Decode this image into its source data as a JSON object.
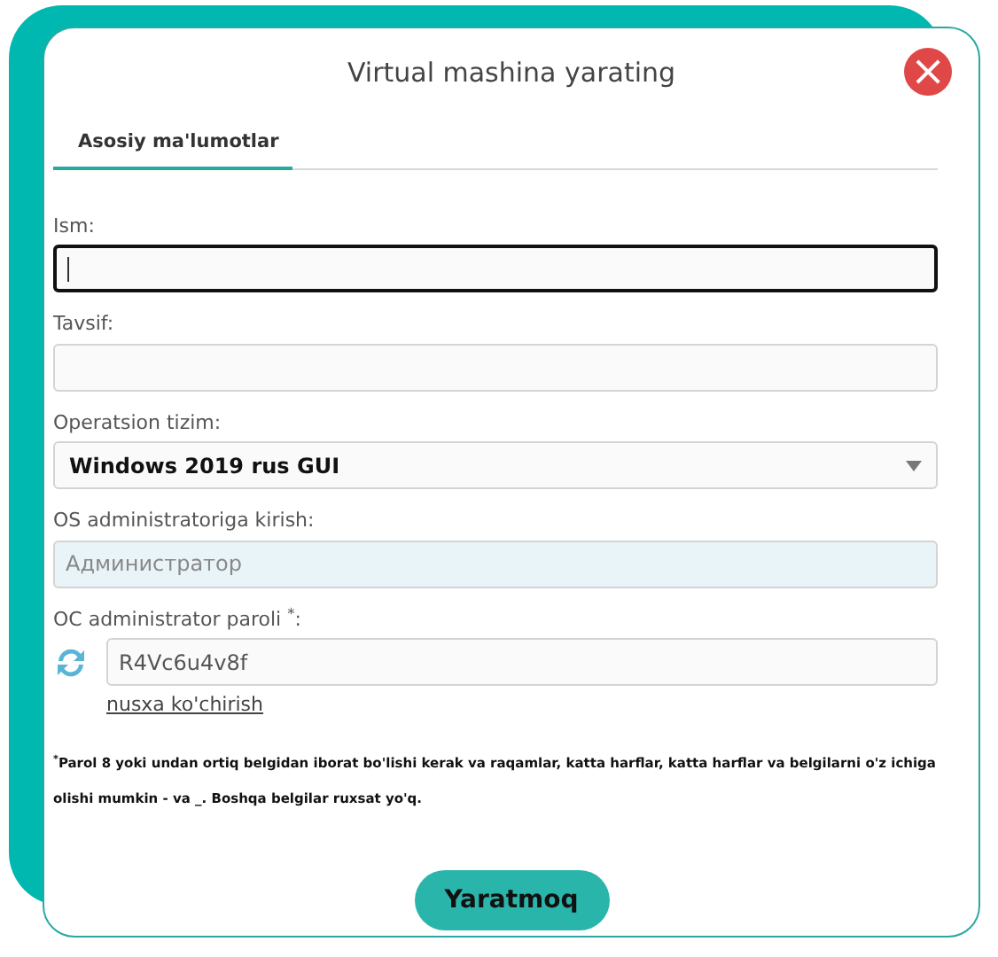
{
  "dialog": {
    "title": "Virtual mashina yarating",
    "close": "×"
  },
  "tabs": [
    {
      "label": "Asosiy ma'lumotlar",
      "selected": true
    }
  ],
  "fields": [
    {
      "kind": "text",
      "label": "Ism:",
      "focused": true
    },
    {
      "kind": "text",
      "label": "Tavsif:",
      "focused": false
    },
    {
      "kind": "select",
      "label": "Operatsion tizim:",
      "value": "Windows 2019 rus GUI",
      "focused": false
    },
    {
      "kind": "readonly",
      "label": "OS administratoriga kirish:",
      "placeholder": "Администратор",
      "focused": false
    },
    {
      "kind": "password",
      "label": "OC administrator paroli $^{*}$:",
      "value": "R4Vc6u4v8f",
      "link": "nusxa ko'chirish",
      "focused": false
    }
  ],
  "note": "$^{*}$Parol 8 yoki undan ortiq belgidan iborat bo'lishi kerak va raqamlar, katta harflar, katta harflar va belgilarni o'z ichiga olishi mumkin - va _. Boshqa belgilar ruxsat yo'q.",
  "submit": "Yaratmoq"
}
